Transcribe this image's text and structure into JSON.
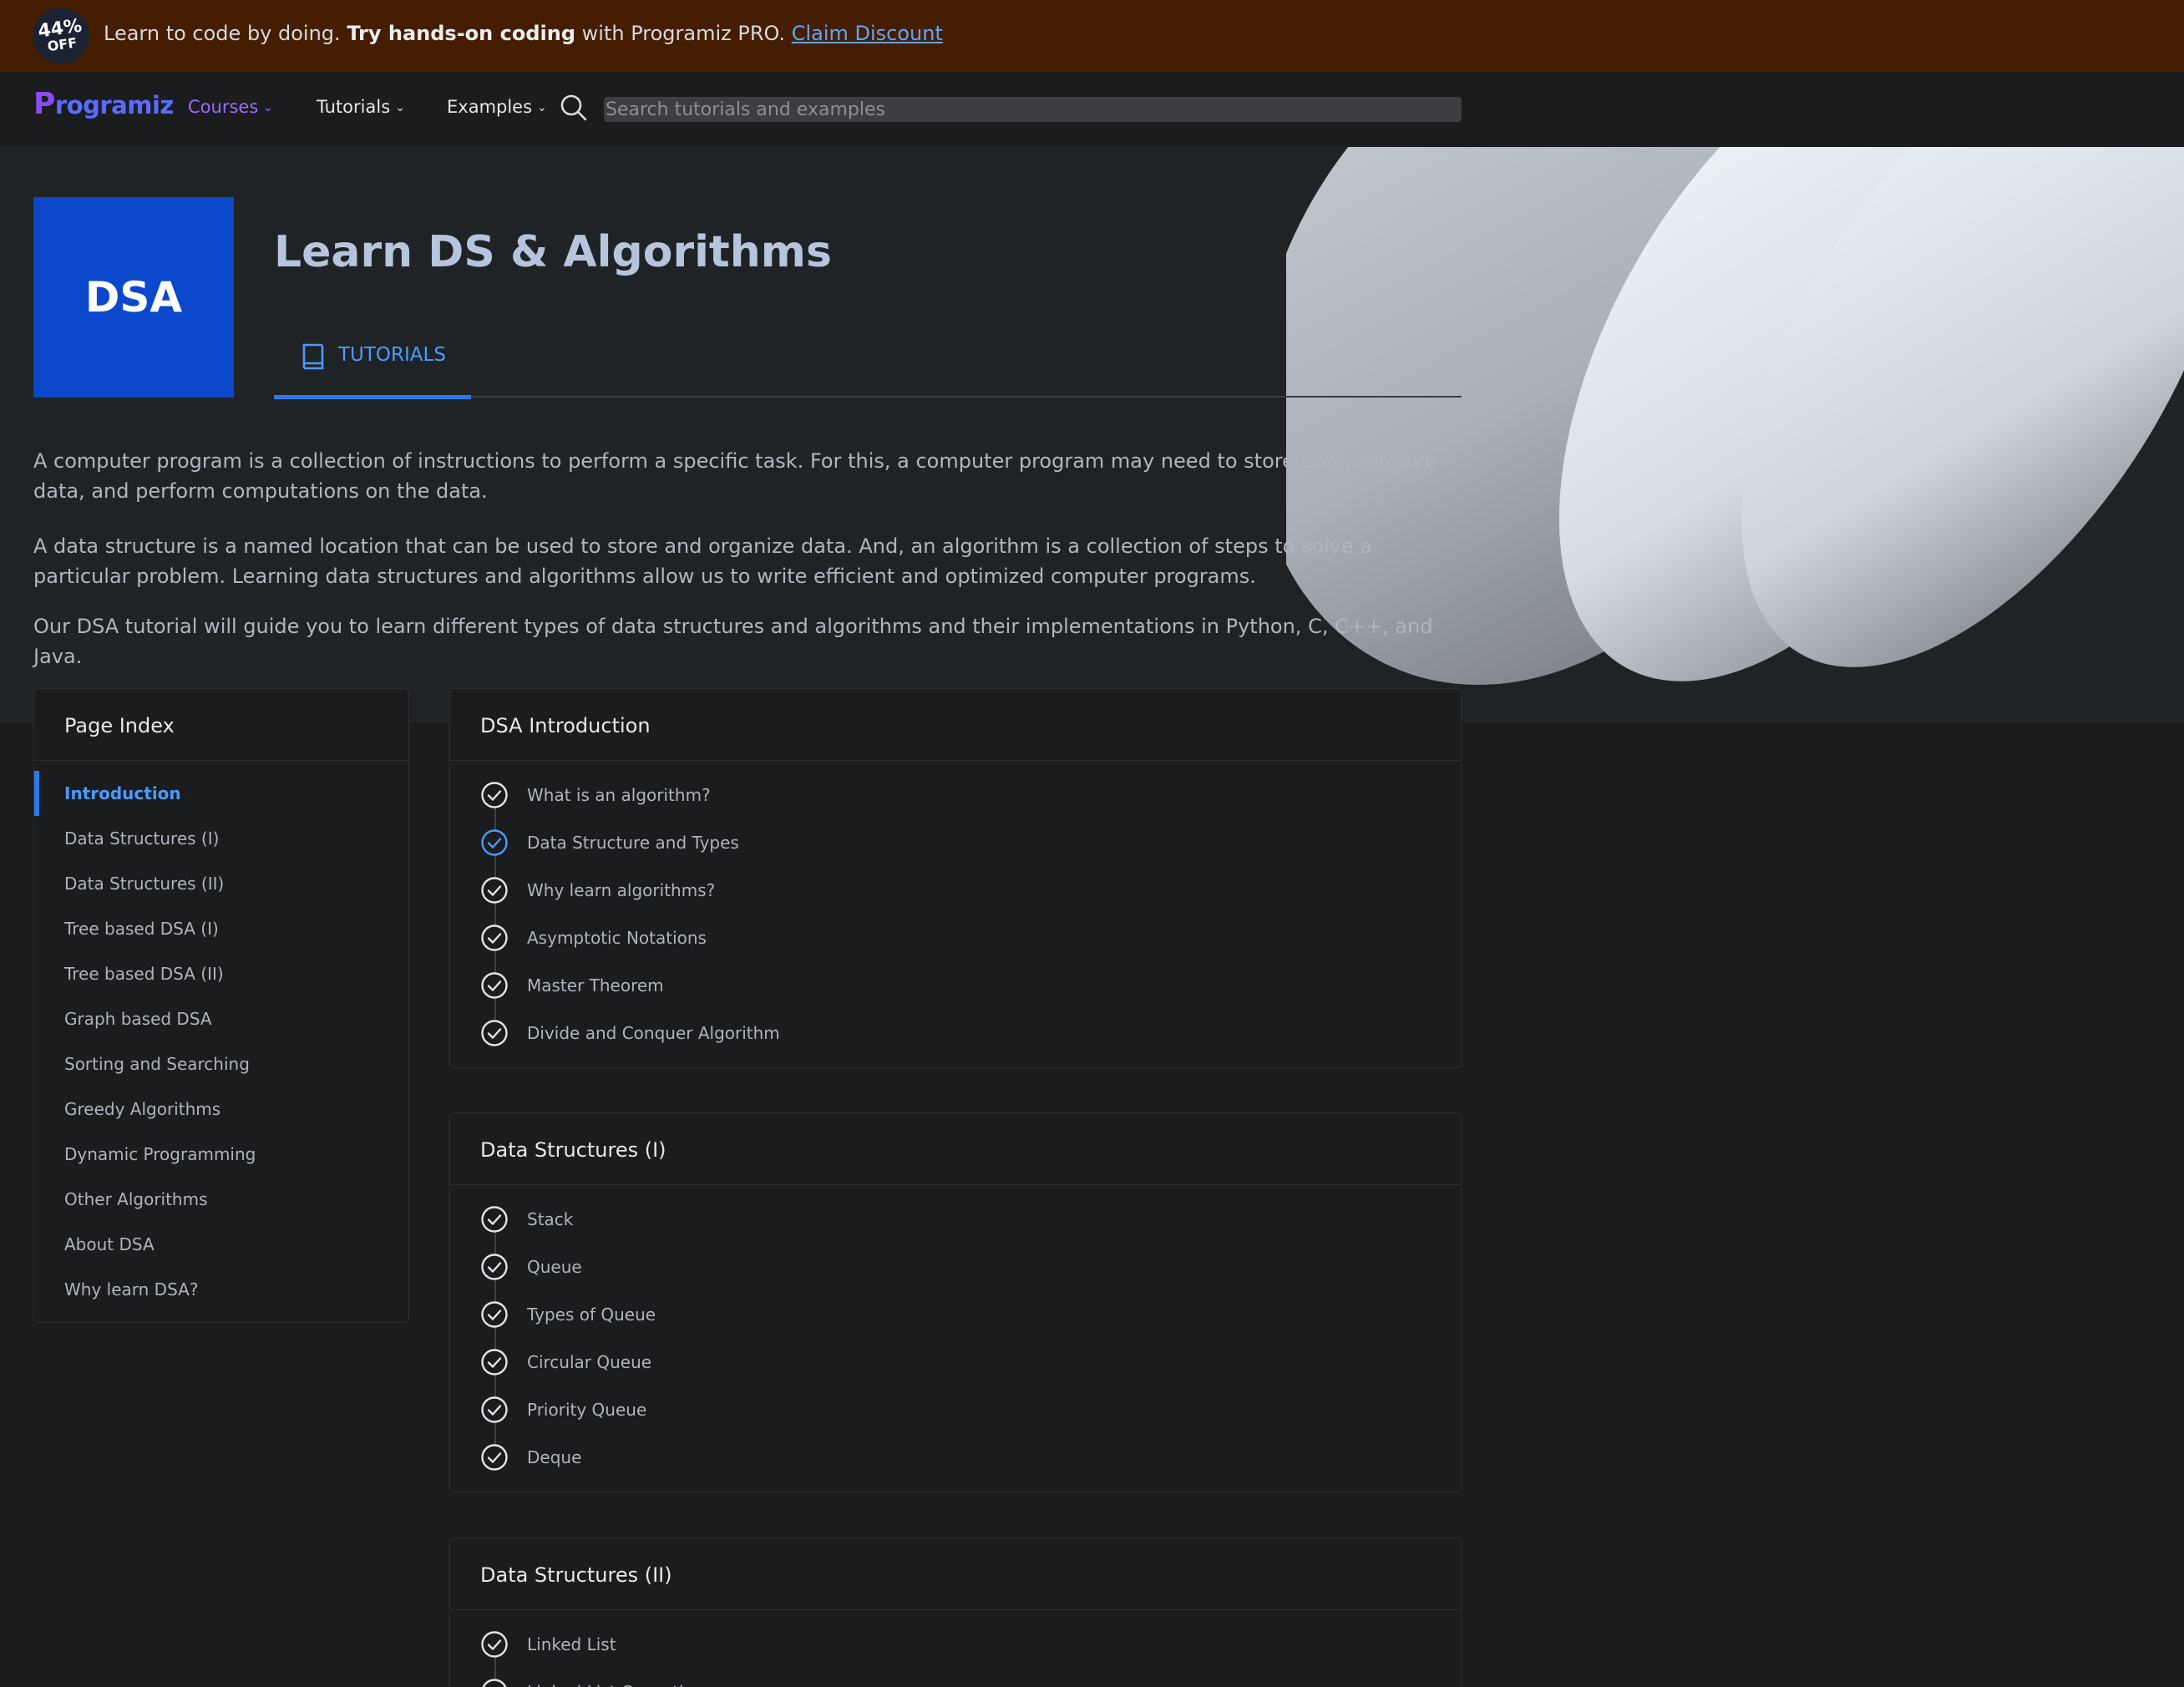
{
  "promo": {
    "badge_pct": "44%",
    "badge_off": "OFF",
    "text_start": "Learn to code by doing.",
    "text_bold": "Try hands-on coding",
    "text_end": "with Programiz PRO.",
    "link": "Claim Discount"
  },
  "nav": {
    "logo": "rogramiz",
    "logo_p": "P",
    "courses": "Courses",
    "tutorials": "Tutorials",
    "examples": "Examples",
    "search_placeholder": "Search tutorials and examples"
  },
  "hero": {
    "tile": "DSA",
    "title": "Learn DS & Algorithms",
    "tab": "TUTORIALS",
    "p1": "A computer program is a collection of instructions to perform a specific task. For this, a computer program may need to store data, retrieve data, and perform computations on the data.",
    "p2": "A data structure is a named location that can be used to store and organize data. And, an algorithm is a collection of steps to solve a particular problem. Learning data structures and algorithms allow us to write efficient and optimized computer programs.",
    "p3": "Our DSA tutorial will guide you to learn different types of data structures and algorithms and their implementations in Python, C, C++, and Java."
  },
  "sidebar": {
    "title": "Page Index",
    "items": [
      "Introduction",
      "Data Structures (I)",
      "Data Structures (II)",
      "Tree based DSA (I)",
      "Tree based DSA (II)",
      "Graph based DSA",
      "Sorting and Searching",
      "Greedy Algorithms",
      "Dynamic Programming",
      "Other Algorithms",
      "About DSA",
      "Why learn DSA?"
    ],
    "active": "Introduction"
  },
  "sections": [
    {
      "title": "DSA Introduction",
      "items": [
        "What is an algorithm?",
        "Data Structure and Types",
        "Why learn algorithms?",
        "Asymptotic Notations",
        "Master Theorem",
        "Divide and Conquer Algorithm"
      ]
    },
    {
      "title": "Data Structures (I)",
      "items": [
        "Stack",
        "Queue",
        "Types of Queue",
        "Circular Queue",
        "Priority Queue",
        "Deque"
      ]
    },
    {
      "title": "Data Structures (II)",
      "items": [
        "Linked List",
        "Linked List Operations"
      ]
    }
  ],
  "colors": {
    "accent": "#2a7be8",
    "promo_bg": "#451d00",
    "tile_bg": "#0b48cc",
    "highlight_check": "#4a9bff"
  }
}
